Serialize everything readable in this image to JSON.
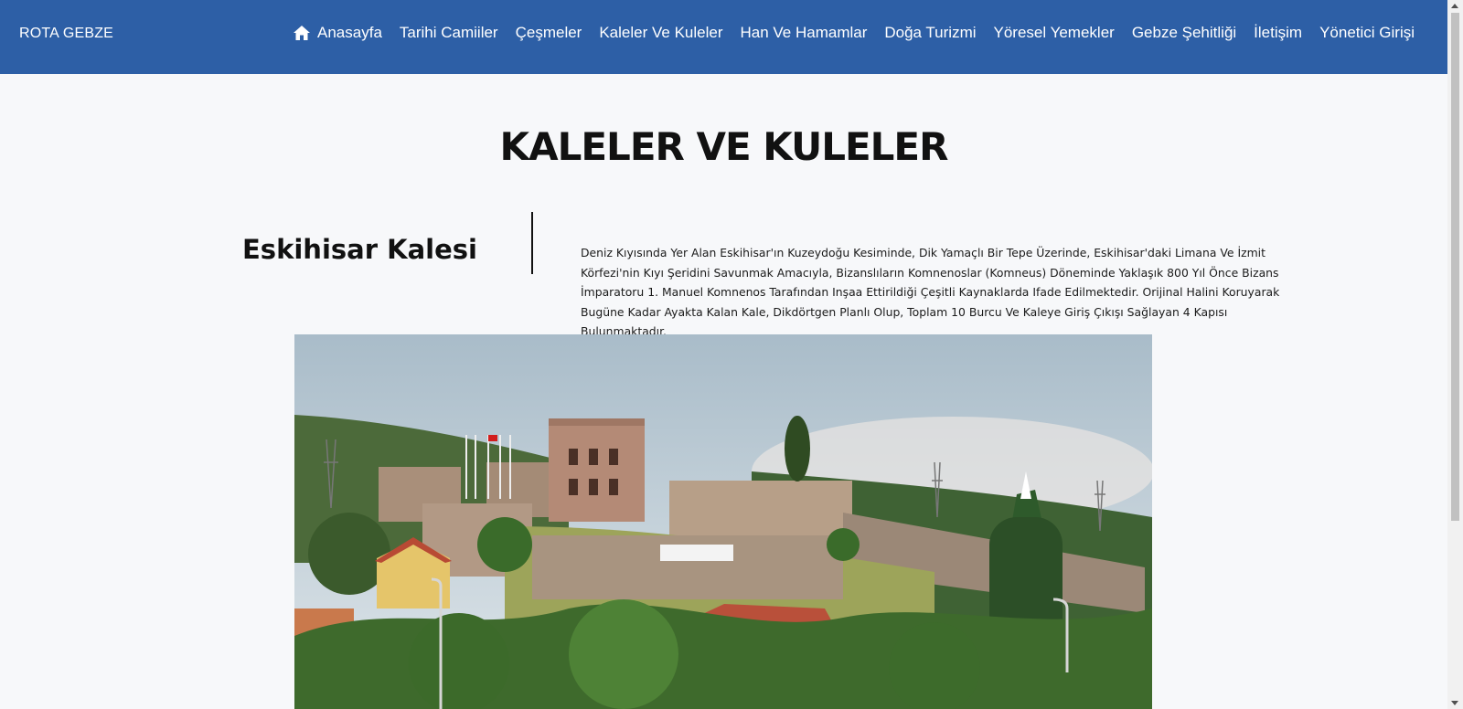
{
  "navbar": {
    "brand": "ROTA GEBZE",
    "items": [
      {
        "label": "Anasayfa",
        "icon": "home-icon"
      },
      {
        "label": "Tarihi Camiiler"
      },
      {
        "label": "Çeşmeler"
      },
      {
        "label": "Kaleler Ve Kuleler"
      },
      {
        "label": "Han Ve Hamamlar"
      },
      {
        "label": "Doğa Turizmi"
      },
      {
        "label": "Yöresel Yemekler"
      },
      {
        "label": "Gebze Şehitliği"
      },
      {
        "label": "İletişim"
      },
      {
        "label": "Yönetici Girişi"
      }
    ]
  },
  "page": {
    "title": "KALELER VE KULELER"
  },
  "section": {
    "heading": "Eskihisar Kalesi",
    "text": "Deniz Kıyısında Yer Alan Eskihisar'ın Kuzeydoğu Kesiminde, Dik Yamaçlı Bir Tepe Üzerinde, Eskihisar'daki Limana Ve İzmit Körfezi'nin Kıyı Şeridini Savunmak Amacıyla, Bizanslıların Komnenoslar (Komneus) Döneminde Yaklaşık 800 Yıl Önce Bizans İmparatoru 1. Manuel Komnenos Tarafından Inşaa Ettirildiği Çeşitli Kaynaklarda Ifade Edilmektedir. Orijinal Halini Koruyarak Bugüne Kadar Ayakta Kalan Kale, Dikdörtgen Planlı Olup, Toplam 10 Burcu Ve Kaleye Giriş Çıkışı Sağlayan 4 Kapısı Bulunmaktadır."
  },
  "colors": {
    "navbar": "#2d5fa6",
    "background": "#f7f8fa"
  }
}
